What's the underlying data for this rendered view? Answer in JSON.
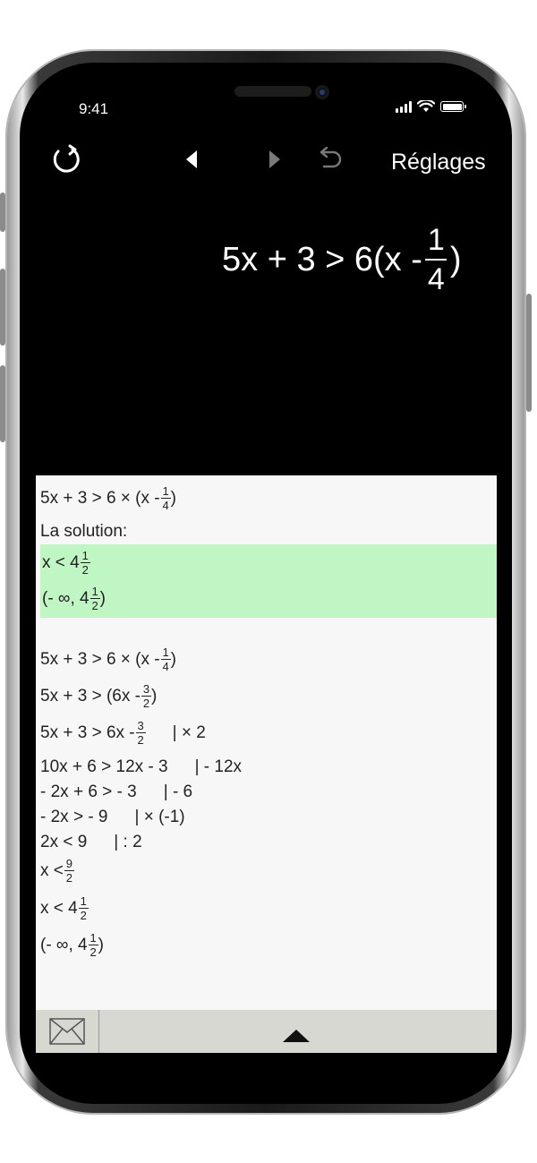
{
  "status": {
    "time": "9:41"
  },
  "toolbar": {
    "settings_label": "Réglages"
  },
  "expression": {
    "left": "5x + 3 > 6(x -",
    "num": "1",
    "den": "4",
    "right": ")"
  },
  "content": {
    "solution_label": "La solution:",
    "top_line": {
      "text": "5x + 3 > 6 × (x -",
      "num": "1",
      "den": "4",
      "after": ")"
    },
    "solution": [
      {
        "text": "x < 4",
        "num": "1",
        "den": "2",
        "after": ""
      },
      {
        "text": "(- ∞, 4",
        "num": "1",
        "den": "2",
        "after": ")"
      }
    ],
    "steps": {
      "s1": {
        "text": "5x + 3 > 6 × (x -",
        "num": "1",
        "den": "4",
        "after": ")"
      },
      "s2": {
        "text": "5x + 3 > (6x -",
        "num": "3",
        "den": "2",
        "after": ")"
      },
      "s3": {
        "text": "5x + 3 > 6x -",
        "num": "3",
        "den": "2",
        "op": "| × 2"
      },
      "s4": {
        "text": "10x + 6 > 12x - 3",
        "op": "| - 12x"
      },
      "s5": {
        "text": "- 2x + 6 > - 3",
        "op": "| - 6"
      },
      "s6": {
        "text": "- 2x > - 9",
        "op": "| × (-1)"
      },
      "s7": {
        "text": "2x < 9",
        "op": "| : 2"
      },
      "s8": {
        "text": "x <",
        "num": "9",
        "den": "2"
      },
      "s9": {
        "text": "x < 4",
        "num": "1",
        "den": "2"
      },
      "s10": {
        "text": "(- ∞, 4",
        "num": "1",
        "den": "2",
        "after": ")"
      }
    }
  },
  "icons": [
    "reset-icon",
    "back-arrow-icon",
    "forward-arrow-icon",
    "undo-icon",
    "mail-icon",
    "collapse-up-icon"
  ]
}
